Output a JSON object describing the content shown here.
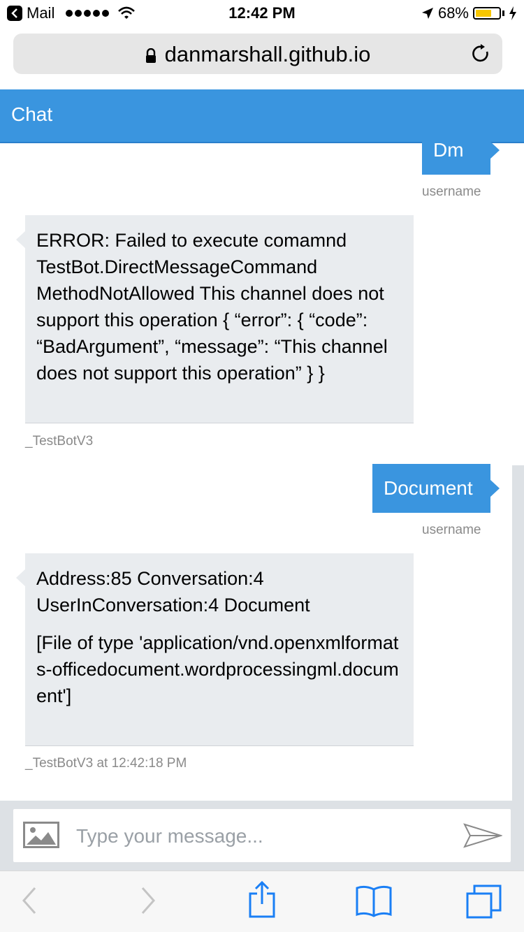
{
  "status_bar": {
    "back_app": "Mail",
    "time": "12:42 PM",
    "battery_percent_label": "68%",
    "battery_level": 0.68,
    "battery_color": "#f7c600"
  },
  "browser": {
    "url": "danmarshall.github.io",
    "lock_icon": "lock-icon",
    "reload_icon": "reload-icon"
  },
  "chat": {
    "title": "Chat",
    "header_color": "#3a95df",
    "messages": [
      {
        "from": "user",
        "text": "Dm",
        "meta": "username"
      },
      {
        "from": "bot",
        "paragraphs": [
          "ERROR: Failed to execute comamnd TestBot.DirectMessageCommand MethodNotAllowed This channel does not support this operation { “error”: { “code”: “BadArgument”, “message”: “This channel does not support this operation” } }"
        ],
        "meta": "_TestBotV3"
      },
      {
        "from": "user",
        "text": "Document",
        "meta": "username"
      },
      {
        "from": "bot",
        "paragraphs": [
          "Address:85 Conversation:4 UserInConversation:4 Document",
          "[File of type 'application/vnd.openxmlformats-officedocument.wordprocessingml.document']"
        ],
        "meta": "_TestBotV3 at 12:42:18 PM"
      }
    ]
  },
  "composer": {
    "placeholder": "Type your message...",
    "value": ""
  }
}
